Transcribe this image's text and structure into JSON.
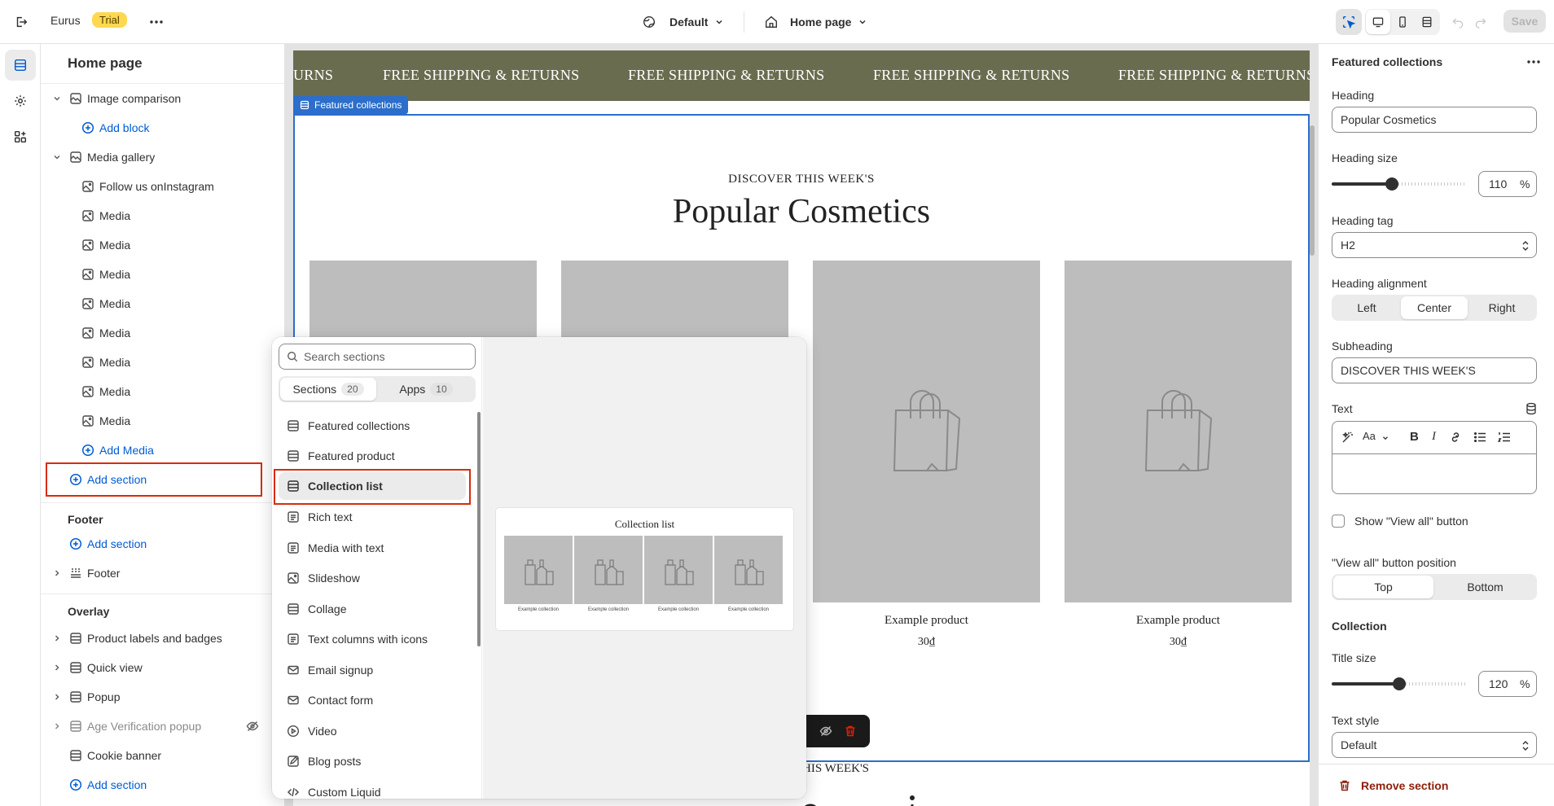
{
  "topbar": {
    "store_name": "Eurus",
    "trial_badge": "Trial",
    "theme_label": "Default",
    "page_label": "Home page",
    "save_label": "Save"
  },
  "sidebar": {
    "title": "Home page",
    "items": [
      {
        "label": "Image comparison",
        "icon": "section-icon"
      },
      {
        "label": "Add block",
        "icon": "plus-circle-icon"
      },
      {
        "label": "Media gallery",
        "icon": "section-icon"
      },
      {
        "label": "Follow us onInstagram",
        "icon": "image-icon"
      },
      {
        "label": "Media",
        "icon": "image-icon"
      },
      {
        "label": "Media",
        "icon": "image-icon"
      },
      {
        "label": "Media",
        "icon": "image-icon"
      },
      {
        "label": "Media",
        "icon": "image-icon"
      },
      {
        "label": "Media",
        "icon": "image-icon"
      },
      {
        "label": "Media",
        "icon": "image-icon"
      },
      {
        "label": "Media",
        "icon": "image-icon"
      },
      {
        "label": "Media",
        "icon": "image-icon"
      },
      {
        "label": "Add Media",
        "icon": "plus-circle-icon"
      },
      {
        "label": "Add section",
        "icon": "plus-circle-icon"
      }
    ],
    "footer_title": "Footer",
    "footer_add": "Add section",
    "footer_item": "Footer",
    "overlay_title": "Overlay",
    "overlay_items": [
      "Product labels and badges",
      "Quick view",
      "Popup",
      "Age Verification popup",
      "Cookie banner"
    ],
    "overlay_add": "Add section"
  },
  "preview": {
    "marquee": [
      "URNS",
      "FREE SHIPPING & RETURNS",
      "FREE SHIPPING & RETURNS",
      "FREE SHIPPING & RETURNS",
      "FREE SHIPPING & RETURNS"
    ],
    "selected_badge": "Featured collections",
    "subheading": "DISCOVER THIS WEEK'S",
    "heading": "Popular Cosmetics",
    "products": [
      {
        "title": "Example product",
        "price": "30₫"
      },
      {
        "title": "Example product",
        "price": "30₫"
      }
    ],
    "next_subheading": "HIS WEEK'S"
  },
  "picker": {
    "search_placeholder": "Search sections",
    "tabs": [
      {
        "label": "Sections",
        "count": "20"
      },
      {
        "label": "Apps",
        "count": "10"
      }
    ],
    "items": [
      {
        "label": "Featured collections",
        "icon": "section-icon"
      },
      {
        "label": "Featured product",
        "icon": "section-icon"
      },
      {
        "label": "Collection list",
        "icon": "section-icon"
      },
      {
        "label": "Rich text",
        "icon": "text-icon"
      },
      {
        "label": "Media with text",
        "icon": "text-icon"
      },
      {
        "label": "Slideshow",
        "icon": "slideshow-icon"
      },
      {
        "label": "Collage",
        "icon": "section-icon"
      },
      {
        "label": "Text columns with icons",
        "icon": "text-icon"
      },
      {
        "label": "Email signup",
        "icon": "email-icon"
      },
      {
        "label": "Contact form",
        "icon": "email-icon"
      },
      {
        "label": "Video",
        "icon": "play-icon"
      },
      {
        "label": "Blog posts",
        "icon": "blog-icon"
      },
      {
        "label": "Custom Liquid",
        "icon": "code-icon"
      }
    ],
    "preview_title": "Collection list",
    "preview_caption": "Example collection"
  },
  "settings": {
    "title": "Featured collections",
    "heading_label": "Heading",
    "heading_value": "Popular Cosmetics",
    "heading_size_label": "Heading size",
    "heading_size_value": "110",
    "heading_size_unit": "%",
    "heading_size_fraction": 0.45,
    "heading_tag_label": "Heading tag",
    "heading_tag_value": "H2",
    "alignment_label": "Heading alignment",
    "alignment_options": [
      "Left",
      "Center",
      "Right"
    ],
    "alignment_selected": "Center",
    "subheading_label": "Subheading",
    "subheading_value": "DISCOVER THIS WEEK'S",
    "text_label": "Text",
    "show_view_all_label": "Show \"View all\" button",
    "view_all_position_label": "\"View all\" button position",
    "view_all_options": [
      "Top",
      "Bottom"
    ],
    "view_all_selected": "Top",
    "collection_title": "Collection",
    "title_size_label": "Title size",
    "title_size_value": "120",
    "title_size_unit": "%",
    "title_size_fraction": 0.5,
    "text_style_label": "Text style",
    "text_style_value": "Default",
    "remove_label": "Remove section"
  },
  "colors": {
    "accent": "#005bd3",
    "selection": "#2c6ecb",
    "highlight_box": "#d72c0d",
    "marquee_bg": "#6a6c4f",
    "placeholder": "#bdbdbd",
    "danger": "#8e1f0b"
  }
}
